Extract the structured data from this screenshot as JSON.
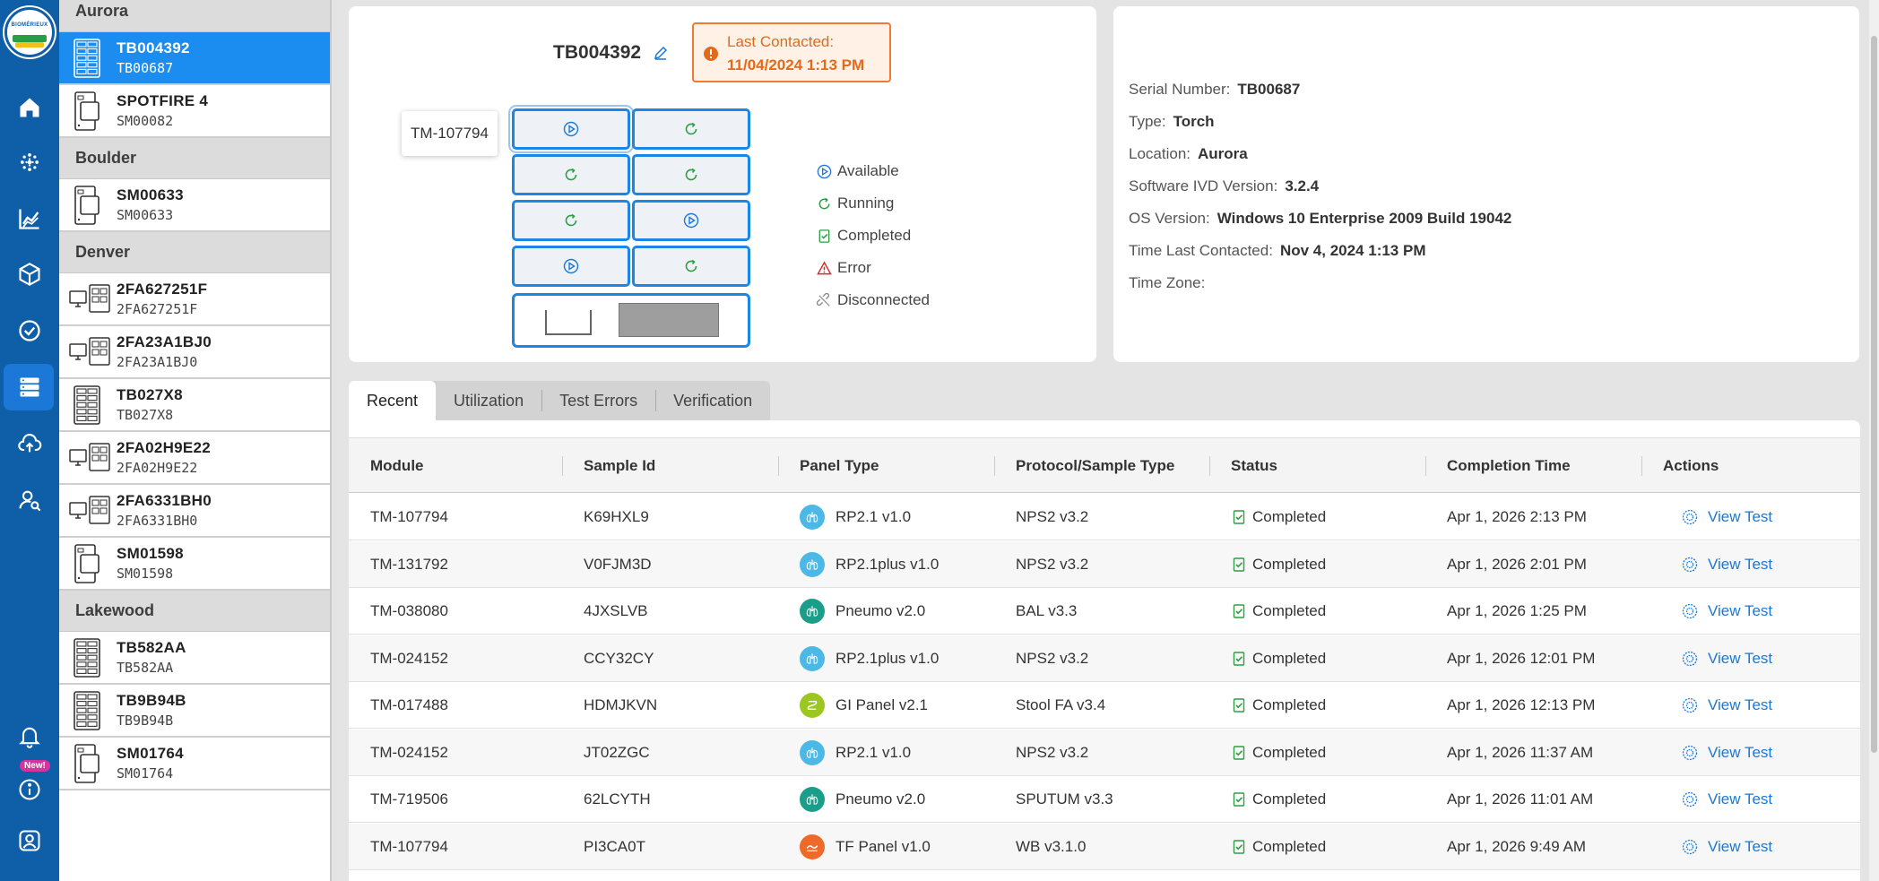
{
  "colors": {
    "rail": "#0f5ea8",
    "selected": "#1b8df0",
    "accent": "#1a87e6",
    "warning": "#e36a1b",
    "completed": "#2e9e44"
  },
  "logo_text": "BIOMÉRIEUX",
  "nav": {
    "items": [
      "home-icon",
      "network-icon",
      "chart-icon",
      "box-icon",
      "check-circle-icon",
      "database-icon",
      "cloud-upload-icon",
      "user-search-icon"
    ],
    "bottom": [
      "bell-icon",
      "info-icon",
      "profile-icon"
    ],
    "new_badge": "New!"
  },
  "locations": [
    {
      "name": "Aurora",
      "devices": [
        {
          "name": "TB004392",
          "serial": "TB00687",
          "icon": "torch-icon",
          "selected": true
        },
        {
          "name": "SPOTFIRE 4",
          "serial": "SM00082",
          "icon": "spotfire-icon"
        }
      ]
    },
    {
      "name": "Boulder",
      "devices": [
        {
          "name": "SM00633",
          "serial": "SM00633",
          "icon": "spotfire-icon"
        }
      ]
    },
    {
      "name": "Denver",
      "devices": [
        {
          "name": "2FA627251F",
          "serial": "2FA627251F",
          "icon": "workstation-icon"
        },
        {
          "name": "2FA23A1BJ0",
          "serial": "2FA23A1BJ0",
          "icon": "workstation-icon"
        },
        {
          "name": "TB027X8",
          "serial": "TB027X8",
          "icon": "torch-icon"
        },
        {
          "name": "2FA02H9E22",
          "serial": "2FA02H9E22",
          "icon": "workstation-icon"
        },
        {
          "name": "2FA6331BH0",
          "serial": "2FA6331BH0",
          "icon": "workstation-icon"
        },
        {
          "name": "SM01598",
          "serial": "SM01598",
          "icon": "spotfire-icon"
        }
      ]
    },
    {
      "name": "Lakewood",
      "devices": [
        {
          "name": "TB582AA",
          "serial": "TB582AA",
          "icon": "torch-icon"
        },
        {
          "name": "TB9B94B",
          "serial": "TB9B94B",
          "icon": "torch-icon"
        },
        {
          "name": "SM01764",
          "serial": "SM01764",
          "icon": "spotfire-icon"
        }
      ]
    }
  ],
  "device": {
    "title": "TB004392",
    "last_contacted_label": "Last Contacted:",
    "last_contacted_value": "11/04/2024 1:13 PM",
    "tooltip": "TM-107794",
    "modules": [
      "available",
      "running",
      "running",
      "running",
      "running",
      "available",
      "available",
      "running"
    ]
  },
  "legend": [
    {
      "state": "available",
      "label": "Available",
      "icon": "play-circle-icon"
    },
    {
      "state": "running",
      "label": "Running",
      "icon": "running-icon"
    },
    {
      "state": "completed",
      "label": "Completed",
      "icon": "completed-icon"
    },
    {
      "state": "error",
      "label": "Error",
      "icon": "warning-triangle-icon"
    },
    {
      "state": "disconnected",
      "label": "Disconnected",
      "icon": "link-broken-icon"
    }
  ],
  "info": [
    {
      "label": "Serial Number:",
      "value": "TB00687"
    },
    {
      "label": "Type:",
      "value": "Torch"
    },
    {
      "label": "Location:",
      "value": "Aurora"
    },
    {
      "label": "Software IVD Version:",
      "value": "3.2.4"
    },
    {
      "label": "OS Version:",
      "value": "Windows 10 Enterprise 2009 Build 19042"
    },
    {
      "label": "Time Last Contacted:",
      "value": "Nov 4, 2024 1:13 PM"
    },
    {
      "label": "Time Zone:",
      "value": ""
    }
  ],
  "tabs": [
    {
      "label": "Recent",
      "active": true
    },
    {
      "label": "Utilization"
    },
    {
      "label": "Test Errors"
    },
    {
      "label": "Verification"
    }
  ],
  "table": {
    "columns": [
      "Module",
      "Sample Id",
      "Panel Type",
      "Protocol/Sample Type",
      "Status",
      "Completion Time",
      "Actions"
    ],
    "action_label": "View Test",
    "rows": [
      {
        "module": "TM-107794",
        "sample": "K69HXL9",
        "panel": "RP2.1 v1.0",
        "panel_icon": "lungs-icon",
        "panel_color": "#4cb8e6",
        "protocol": "NPS2 v3.2",
        "status": "Completed",
        "time": "Apr 1, 2026 2:13 PM"
      },
      {
        "module": "TM-131792",
        "sample": "V0FJM3D",
        "panel": "RP2.1plus v1.0",
        "panel_icon": "lungs-icon",
        "panel_color": "#4cb8e6",
        "protocol": "NPS2 v3.2",
        "status": "Completed",
        "time": "Apr 1, 2026 2:01 PM"
      },
      {
        "module": "TM-038080",
        "sample": "4JXSLVB",
        "panel": "Pneumo v2.0",
        "panel_icon": "lungs-icon",
        "panel_color": "#1a9e8a",
        "protocol": "BAL v3.3",
        "status": "Completed",
        "time": "Apr 1, 2026 1:25 PM"
      },
      {
        "module": "TM-024152",
        "sample": "CCY32CY",
        "panel": "RP2.1plus v1.0",
        "panel_icon": "lungs-icon",
        "panel_color": "#4cb8e6",
        "protocol": "NPS2 v3.2",
        "status": "Completed",
        "time": "Apr 1, 2026 12:01 PM"
      },
      {
        "module": "TM-017488",
        "sample": "HDMJKVN",
        "panel": "GI Panel v2.1",
        "panel_icon": "gut-icon",
        "panel_color": "#9cc720",
        "protocol": "Stool FA v3.4",
        "status": "Completed",
        "time": "Apr 1, 2026 12:13 PM"
      },
      {
        "module": "TM-024152",
        "sample": "JT02ZGC",
        "panel": "RP2.1 v1.0",
        "panel_icon": "lungs-icon",
        "panel_color": "#4cb8e6",
        "protocol": "NPS2 v3.2",
        "status": "Completed",
        "time": "Apr 1, 2026 11:37 AM"
      },
      {
        "module": "TM-719506",
        "sample": "62LCYTH",
        "panel": "Pneumo v2.0",
        "panel_icon": "lungs-icon",
        "panel_color": "#1a9e8a",
        "protocol": "SPUTUM v3.3",
        "status": "Completed",
        "time": "Apr 1, 2026 11:01 AM"
      },
      {
        "module": "TM-107794",
        "sample": "PI3CA0T",
        "panel": "TF Panel v1.0",
        "panel_icon": "wave-icon",
        "panel_color": "#ef6a2a",
        "protocol": "WB v3.1.0",
        "status": "Completed",
        "time": "Apr 1, 2026 9:49 AM"
      }
    ]
  }
}
